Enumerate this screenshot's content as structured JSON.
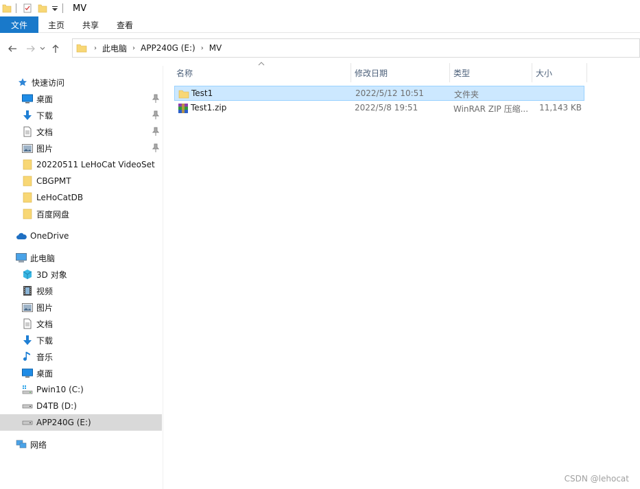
{
  "window": {
    "title": "MV"
  },
  "ribbon": {
    "tabs": [
      "文件",
      "主页",
      "共享",
      "查看"
    ]
  },
  "address": {
    "crumbs": [
      "此电脑",
      "APP240G (E:)",
      "MV"
    ]
  },
  "sidebar": {
    "quick_access": "快速访问",
    "pinned": [
      {
        "label": "桌面",
        "icon": "desktop-icon"
      },
      {
        "label": "下载",
        "icon": "download-icon"
      },
      {
        "label": "文档",
        "icon": "document-icon"
      },
      {
        "label": "图片",
        "icon": "pictures-icon"
      }
    ],
    "folders": [
      "20220511 LeHoCat VideoSet",
      "CBGPMT",
      "LeHoCatDB",
      "百度网盘"
    ],
    "onedrive": "OneDrive",
    "this_pc": "此电脑",
    "pc_items": [
      {
        "label": "3D 对象",
        "icon": "3d-objects-icon"
      },
      {
        "label": "视频",
        "icon": "video-icon"
      },
      {
        "label": "图片",
        "icon": "pictures-icon"
      },
      {
        "label": "文档",
        "icon": "document-icon"
      },
      {
        "label": "下载",
        "icon": "download-icon"
      },
      {
        "label": "音乐",
        "icon": "music-icon"
      },
      {
        "label": "桌面",
        "icon": "desktop-icon"
      },
      {
        "label": "Pwin10 (C:)",
        "icon": "windows-drive-icon"
      },
      {
        "label": "D4TB (D:)",
        "icon": "drive-icon"
      },
      {
        "label": "APP240G (E:)",
        "icon": "drive-icon"
      }
    ],
    "selected": "APP240G (E:)",
    "network": "网络"
  },
  "columns": {
    "name": "名称",
    "date": "修改日期",
    "type": "类型",
    "size": "大小"
  },
  "files": [
    {
      "name": "Test1",
      "date": "2022/5/12 10:51",
      "type": "文件夹",
      "size": "",
      "icon": "folder-icon"
    },
    {
      "name": "Test1.zip",
      "date": "2022/5/8 19:51",
      "type": "WinRAR ZIP 压缩...",
      "size": "11,143 KB",
      "icon": "winrar-archive-icon"
    }
  ],
  "watermark": "CSDN @lehocat",
  "colors": {
    "accent": "#1979ca",
    "selection": "#cce8ff",
    "folder": "#f8d775"
  }
}
